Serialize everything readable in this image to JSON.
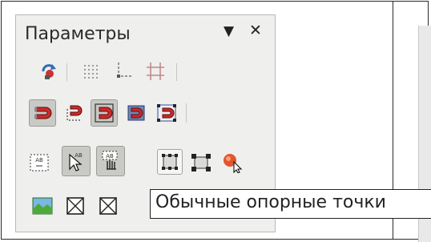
{
  "panel": {
    "title": "Параметры",
    "menu_glyph": "▼",
    "close_glyph": "✕"
  },
  "tooltip": {
    "text": "Обычные опорные точки"
  },
  "toolbar_rows": [
    [
      "rotate-icon",
      "grid-dots-icon",
      "guides-icon",
      "frame-guides-icon"
    ],
    [
      "magnet-red-icon",
      "magnet-snap-grid-icon",
      "magnet-page-icon",
      "magnet-object-icon",
      "magnet-points-icon"
    ],
    [
      "text-box-icon",
      "pointer-text-icon",
      "hand-text-icon",
      "simple-handles-icon",
      "large-handles-icon",
      "point-edit-icon"
    ],
    [
      "image-icon",
      "crossed-box-icon",
      "crossed-box-2-icon"
    ]
  ]
}
